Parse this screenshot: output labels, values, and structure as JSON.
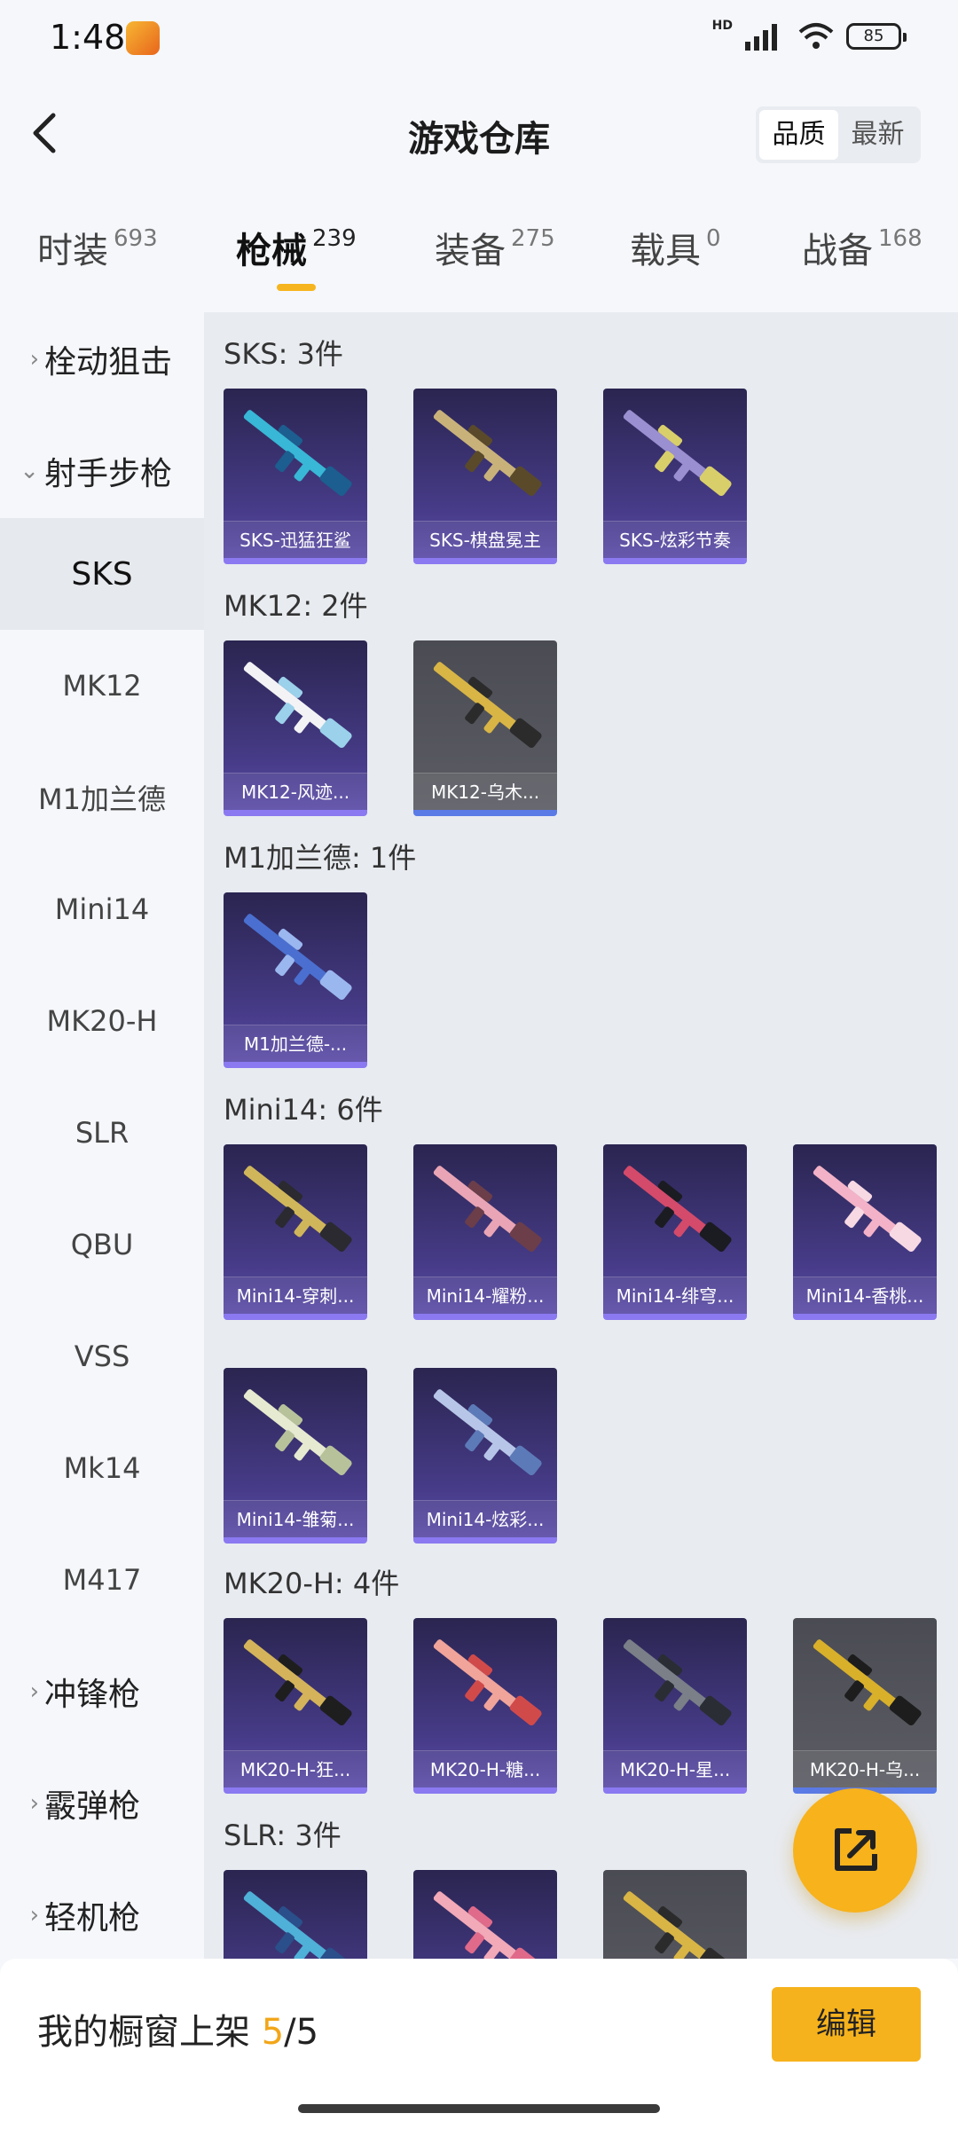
{
  "status_bar": {
    "time": "1:48",
    "network_label": "HD",
    "battery": "85"
  },
  "header": {
    "title": "游戏仓库",
    "sort_options": [
      "品质",
      "最新"
    ],
    "sort_active": "品质"
  },
  "tabs": [
    {
      "label": "时装",
      "count": "693"
    },
    {
      "label": "枪械",
      "count": "239",
      "active": true
    },
    {
      "label": "装备",
      "count": "275"
    },
    {
      "label": "载具",
      "count": "0"
    },
    {
      "label": "战备",
      "count": "168"
    }
  ],
  "sidebar": {
    "items": [
      {
        "label": "栓动狙击",
        "type": "category",
        "expanded": false
      },
      {
        "label": "射手步枪",
        "type": "category",
        "expanded": true
      },
      {
        "label": "SKS",
        "type": "sub",
        "active": true
      },
      {
        "label": "MK12",
        "type": "sub"
      },
      {
        "label": "M1加兰德",
        "type": "sub"
      },
      {
        "label": "Mini14",
        "type": "sub"
      },
      {
        "label": "MK20-H",
        "type": "sub"
      },
      {
        "label": "SLR",
        "type": "sub"
      },
      {
        "label": "QBU",
        "type": "sub"
      },
      {
        "label": "VSS",
        "type": "sub"
      },
      {
        "label": "Mk14",
        "type": "sub"
      },
      {
        "label": "M417",
        "type": "sub"
      },
      {
        "label": "冲锋枪",
        "type": "category",
        "expanded": false
      },
      {
        "label": "霰弹枪",
        "type": "category",
        "expanded": false
      },
      {
        "label": "轻机枪",
        "type": "category",
        "expanded": false
      }
    ]
  },
  "groups": [
    {
      "title": "SKS: 3件",
      "items": [
        {
          "name": "SKS-迅猛狂鲨",
          "tier": "purple"
        },
        {
          "name": "SKS-棋盘冕主",
          "tier": "purple"
        },
        {
          "name": "SKS-炫彩节奏",
          "tier": "purple"
        }
      ]
    },
    {
      "title": "MK12: 2件",
      "items": [
        {
          "name": "MK12-风迹...",
          "tier": "purple"
        },
        {
          "name": "MK12-乌木...",
          "tier": "grey"
        }
      ]
    },
    {
      "title": "M1加兰德: 1件",
      "items": [
        {
          "name": "M1加兰德-...",
          "tier": "purple"
        }
      ]
    },
    {
      "title": "Mini14: 6件",
      "items": [
        {
          "name": "Mini14-穿刺...",
          "tier": "purple"
        },
        {
          "name": "Mini14-耀粉...",
          "tier": "purple"
        },
        {
          "name": "Mini14-绯穹...",
          "tier": "purple"
        },
        {
          "name": "Mini14-香桃...",
          "tier": "purple"
        },
        {
          "name": "Mini14-雏菊...",
          "tier": "purple"
        },
        {
          "name": "Mini14-炫彩...",
          "tier": "purple"
        }
      ]
    },
    {
      "title": "MK20-H: 4件",
      "items": [
        {
          "name": "MK20-H-狂...",
          "tier": "purple"
        },
        {
          "name": "MK20-H-糖...",
          "tier": "purple"
        },
        {
          "name": "MK20-H-星...",
          "tier": "purple"
        },
        {
          "name": "MK20-H-乌...",
          "tier": "grey"
        }
      ]
    },
    {
      "title": "SLR: 3件",
      "items": [
        {
          "name": "",
          "tier": "purple"
        },
        {
          "name": "",
          "tier": "purple"
        },
        {
          "name": "",
          "tier": "grey"
        }
      ]
    }
  ],
  "bottom": {
    "showcase_label": "我的橱窗上架",
    "showcase_current": "5",
    "showcase_total": "/5",
    "edit_label": "编辑"
  },
  "colors": {
    "accent": "#f6b21c",
    "card_purple": "#463b87",
    "card_grey": "#5c5d64"
  }
}
